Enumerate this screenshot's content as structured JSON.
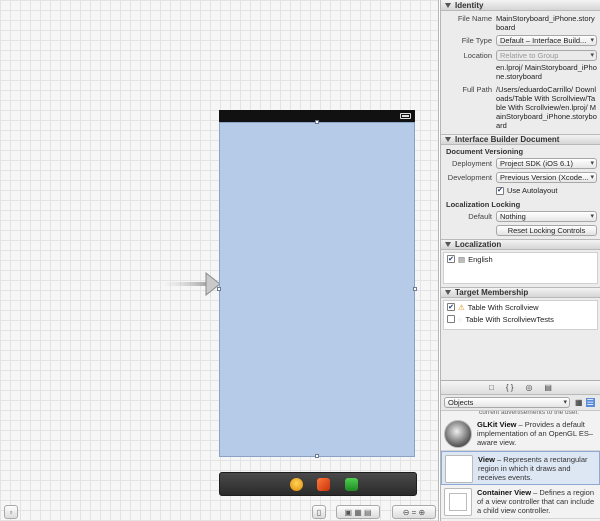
{
  "identity": {
    "header": "Identity",
    "file_name_label": "File Name",
    "file_name_value": "MainStoryboard_iPhone.storyboard",
    "file_type_label": "File Type",
    "file_type_value": "Default – Interface Build...",
    "location_label": "Location",
    "location_value": "Relative to Group",
    "location_path": "en.lproj/ MainStoryboard_iPhone.storyboard",
    "full_path_label": "Full Path",
    "full_path_value": "/Users/eduardoCarrillo/ Downloads/Table With Scrollview/Table With Scrollview/en.lproj/ MainStoryboard_iPhone.storyboard"
  },
  "ib_document": {
    "header": "Interface Builder Document",
    "versioning_label": "Document Versioning",
    "deployment_label": "Deployment",
    "deployment_value": "Project SDK (iOS 6.1)",
    "development_label": "Development",
    "development_value": "Previous Version (Xcode...",
    "autolayout_label": "Use Autolayout",
    "locking_label": "Localization Locking",
    "default_label": "Default",
    "default_value": "Nothing",
    "reset_button": "Reset Locking Controls"
  },
  "localization": {
    "header": "Localization",
    "items": [
      {
        "label": "English"
      }
    ]
  },
  "target_membership": {
    "header": "Target Membership",
    "items": [
      {
        "label": "Table With Scrollview"
      },
      {
        "label": "Table With ScrollviewTests"
      }
    ]
  },
  "library": {
    "tabs": [
      "□",
      "{ }",
      "◎",
      "▤"
    ],
    "filter_value": "Objects",
    "cut_off_text": "current advertisements to the user.",
    "items": [
      {
        "name": "GLKit View",
        "desc": " – Provides a default implementation of an OpenGL ES–aware view."
      },
      {
        "name": "View",
        "desc": " – Represents a rectangular region in which it draws and receives events."
      },
      {
        "name": "Container View",
        "desc": " – Defines a region of a view controller that can include a child view controller."
      }
    ]
  },
  "colors": {
    "view_background": "#b6cbe8",
    "status_bar": "#111111",
    "selection_blue": "#dde6f3"
  }
}
